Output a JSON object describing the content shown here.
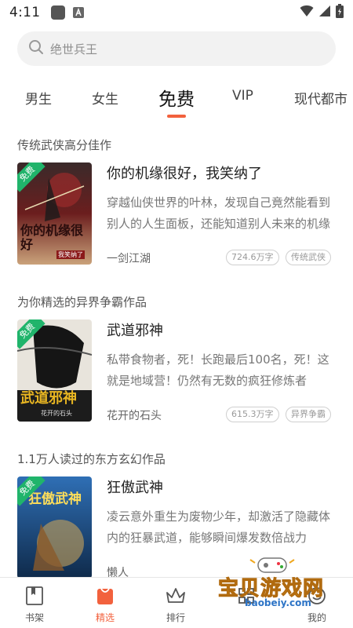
{
  "status_bar": {
    "time": "4:11"
  },
  "search": {
    "placeholder": "绝世兵王"
  },
  "tabs": [
    {
      "label": "男生"
    },
    {
      "label": "女生"
    },
    {
      "label": "免费",
      "active": true
    },
    {
      "label": "VIP"
    },
    {
      "label": "现代都市"
    }
  ],
  "sections": [
    {
      "title": "传统武侠高分佳作",
      "book": {
        "badge": "免费",
        "title": "你的机缘很好，我笑纳了",
        "description": "穿越仙侠世界的叶林，发现自己竟然能看到别人的人生面板，还能知道别人未来的机缘",
        "author": "一剑江湖",
        "word_count": "724.6万字",
        "genre": "传统武侠",
        "cover_text": "你的机缘很好",
        "cover_sub": "我笑纳了"
      }
    },
    {
      "title": "为你精选的异界争霸作品",
      "book": {
        "badge": "免费",
        "title": "武道邪神",
        "description": "私带食物者，死！长跑最后100名，死！这就是地域营！仍然有无数的疯狂修炼者",
        "author": "花开的石头",
        "word_count": "615.3万字",
        "genre": "异界争霸",
        "cover_text": "武道邪神",
        "cover_sub": "花开的石头"
      }
    },
    {
      "title": "1.1万人读过的东方玄幻作品",
      "book": {
        "badge": "免费",
        "title": "狂傲武神",
        "description": "凌云意外重生为废物少年，却激活了隐藏体内的狂暴武道，能够瞬间爆发数倍战力",
        "author": "懒人",
        "word_count": "",
        "genre": "",
        "cover_text": "狂傲武神"
      }
    }
  ],
  "bottom_nav": [
    {
      "label": "书架",
      "icon": "bookshelf-icon"
    },
    {
      "label": "精选",
      "icon": "featured-icon",
      "active": true
    },
    {
      "label": "排行",
      "icon": "ranking-crown-icon"
    },
    {
      "label": "",
      "icon": "category-icon"
    },
    {
      "label": "我的",
      "icon": "profile-icon"
    }
  ],
  "watermark": {
    "main": "宝贝游戏网",
    "url": "baobeiy.com"
  },
  "colors": {
    "accent": "#f2613d",
    "free_badge": "#20b46b"
  }
}
